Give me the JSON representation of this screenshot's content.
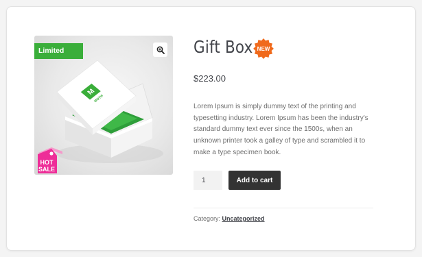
{
  "product": {
    "title": "Gift Box",
    "new_badge": "NEW",
    "price": "$223.00",
    "description": "Lorem Ipsum is simply dummy text of the printing and typesetting industry. Lorem Ipsum has been the industry's standard dummy text ever since the 1500s, when an unknown printer took a galley of type and scrambled it to make a type specimen book.",
    "quantity": "1",
    "add_to_cart_label": "Add to cart",
    "category_label": "Category:",
    "category_value": "Uncategorized"
  },
  "image": {
    "limited_badge": "Limited",
    "hot_sale_line1": "HOT",
    "hot_sale_line2": "SALE",
    "logo_text": "MOTIF",
    "zoom_icon": "magnifier-plus-icon"
  },
  "colors": {
    "limited_green": "#3aae3a",
    "new_orange": "#f06a1c",
    "hot_pink": "#ee2d98",
    "button_dark": "#333333"
  }
}
